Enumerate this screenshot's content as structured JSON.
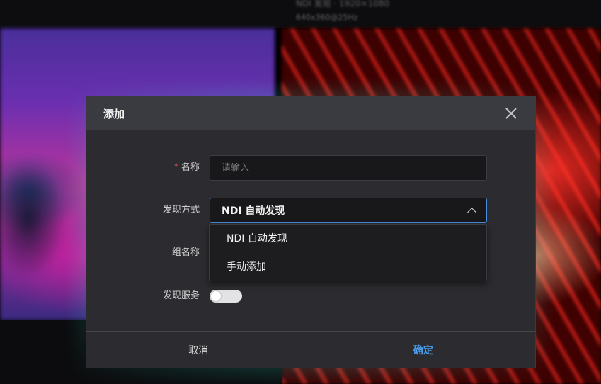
{
  "background": {
    "top_text_line1": "NDI 发现 · 1920×1080",
    "top_text_line2": "640x360@25Hz"
  },
  "dialog": {
    "title": "添加",
    "name_field": {
      "label": "名称",
      "required_mark": "*",
      "placeholder": "请输入",
      "value": ""
    },
    "discovery_mode": {
      "label": "发现方式",
      "selected": "NDI 自动发现",
      "options": [
        "NDI 自动发现",
        "手动添加"
      ],
      "expanded": true
    },
    "group_name": {
      "label": "组名称"
    },
    "discovery_service": {
      "label": "发现服务",
      "enabled": false
    },
    "footer": {
      "cancel_label": "取消",
      "confirm_label": "确定"
    }
  },
  "colors": {
    "accent": "#4a90e2",
    "confirm_text": "#4a9ff0",
    "required_star": "#e0525a",
    "dialog_bg": "#2c2c30",
    "header_bg": "#3a3b41"
  }
}
